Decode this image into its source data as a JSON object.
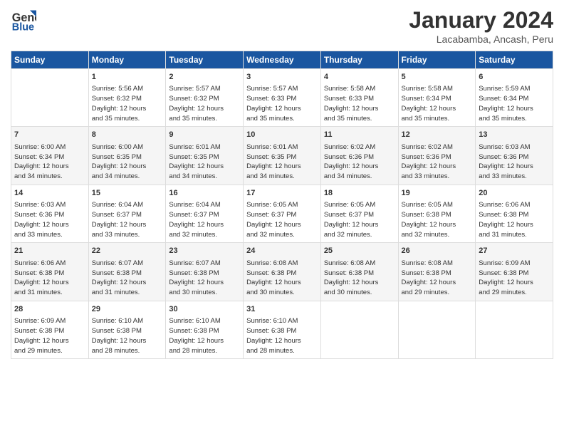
{
  "logo": {
    "line1": "General",
    "line2": "Blue"
  },
  "title": "January 2024",
  "subtitle": "Lacabamba, Ancash, Peru",
  "days_header": [
    "Sunday",
    "Monday",
    "Tuesday",
    "Wednesday",
    "Thursday",
    "Friday",
    "Saturday"
  ],
  "weeks": [
    [
      {
        "day": "",
        "content": ""
      },
      {
        "day": "1",
        "content": "Sunrise: 5:56 AM\nSunset: 6:32 PM\nDaylight: 12 hours\nand 35 minutes."
      },
      {
        "day": "2",
        "content": "Sunrise: 5:57 AM\nSunset: 6:32 PM\nDaylight: 12 hours\nand 35 minutes."
      },
      {
        "day": "3",
        "content": "Sunrise: 5:57 AM\nSunset: 6:33 PM\nDaylight: 12 hours\nand 35 minutes."
      },
      {
        "day": "4",
        "content": "Sunrise: 5:58 AM\nSunset: 6:33 PM\nDaylight: 12 hours\nand 35 minutes."
      },
      {
        "day": "5",
        "content": "Sunrise: 5:58 AM\nSunset: 6:34 PM\nDaylight: 12 hours\nand 35 minutes."
      },
      {
        "day": "6",
        "content": "Sunrise: 5:59 AM\nSunset: 6:34 PM\nDaylight: 12 hours\nand 35 minutes."
      }
    ],
    [
      {
        "day": "7",
        "content": "Sunrise: 6:00 AM\nSunset: 6:34 PM\nDaylight: 12 hours\nand 34 minutes."
      },
      {
        "day": "8",
        "content": "Sunrise: 6:00 AM\nSunset: 6:35 PM\nDaylight: 12 hours\nand 34 minutes."
      },
      {
        "day": "9",
        "content": "Sunrise: 6:01 AM\nSunset: 6:35 PM\nDaylight: 12 hours\nand 34 minutes."
      },
      {
        "day": "10",
        "content": "Sunrise: 6:01 AM\nSunset: 6:35 PM\nDaylight: 12 hours\nand 34 minutes."
      },
      {
        "day": "11",
        "content": "Sunrise: 6:02 AM\nSunset: 6:36 PM\nDaylight: 12 hours\nand 34 minutes."
      },
      {
        "day": "12",
        "content": "Sunrise: 6:02 AM\nSunset: 6:36 PM\nDaylight: 12 hours\nand 33 minutes."
      },
      {
        "day": "13",
        "content": "Sunrise: 6:03 AM\nSunset: 6:36 PM\nDaylight: 12 hours\nand 33 minutes."
      }
    ],
    [
      {
        "day": "14",
        "content": "Sunrise: 6:03 AM\nSunset: 6:36 PM\nDaylight: 12 hours\nand 33 minutes."
      },
      {
        "day": "15",
        "content": "Sunrise: 6:04 AM\nSunset: 6:37 PM\nDaylight: 12 hours\nand 33 minutes."
      },
      {
        "day": "16",
        "content": "Sunrise: 6:04 AM\nSunset: 6:37 PM\nDaylight: 12 hours\nand 32 minutes."
      },
      {
        "day": "17",
        "content": "Sunrise: 6:05 AM\nSunset: 6:37 PM\nDaylight: 12 hours\nand 32 minutes."
      },
      {
        "day": "18",
        "content": "Sunrise: 6:05 AM\nSunset: 6:37 PM\nDaylight: 12 hours\nand 32 minutes."
      },
      {
        "day": "19",
        "content": "Sunrise: 6:05 AM\nSunset: 6:38 PM\nDaylight: 12 hours\nand 32 minutes."
      },
      {
        "day": "20",
        "content": "Sunrise: 6:06 AM\nSunset: 6:38 PM\nDaylight: 12 hours\nand 31 minutes."
      }
    ],
    [
      {
        "day": "21",
        "content": "Sunrise: 6:06 AM\nSunset: 6:38 PM\nDaylight: 12 hours\nand 31 minutes."
      },
      {
        "day": "22",
        "content": "Sunrise: 6:07 AM\nSunset: 6:38 PM\nDaylight: 12 hours\nand 31 minutes."
      },
      {
        "day": "23",
        "content": "Sunrise: 6:07 AM\nSunset: 6:38 PM\nDaylight: 12 hours\nand 30 minutes."
      },
      {
        "day": "24",
        "content": "Sunrise: 6:08 AM\nSunset: 6:38 PM\nDaylight: 12 hours\nand 30 minutes."
      },
      {
        "day": "25",
        "content": "Sunrise: 6:08 AM\nSunset: 6:38 PM\nDaylight: 12 hours\nand 30 minutes."
      },
      {
        "day": "26",
        "content": "Sunrise: 6:08 AM\nSunset: 6:38 PM\nDaylight: 12 hours\nand 29 minutes."
      },
      {
        "day": "27",
        "content": "Sunrise: 6:09 AM\nSunset: 6:38 PM\nDaylight: 12 hours\nand 29 minutes."
      }
    ],
    [
      {
        "day": "28",
        "content": "Sunrise: 6:09 AM\nSunset: 6:38 PM\nDaylight: 12 hours\nand 29 minutes."
      },
      {
        "day": "29",
        "content": "Sunrise: 6:10 AM\nSunset: 6:38 PM\nDaylight: 12 hours\nand 28 minutes."
      },
      {
        "day": "30",
        "content": "Sunrise: 6:10 AM\nSunset: 6:38 PM\nDaylight: 12 hours\nand 28 minutes."
      },
      {
        "day": "31",
        "content": "Sunrise: 6:10 AM\nSunset: 6:38 PM\nDaylight: 12 hours\nand 28 minutes."
      },
      {
        "day": "",
        "content": ""
      },
      {
        "day": "",
        "content": ""
      },
      {
        "day": "",
        "content": ""
      }
    ]
  ]
}
